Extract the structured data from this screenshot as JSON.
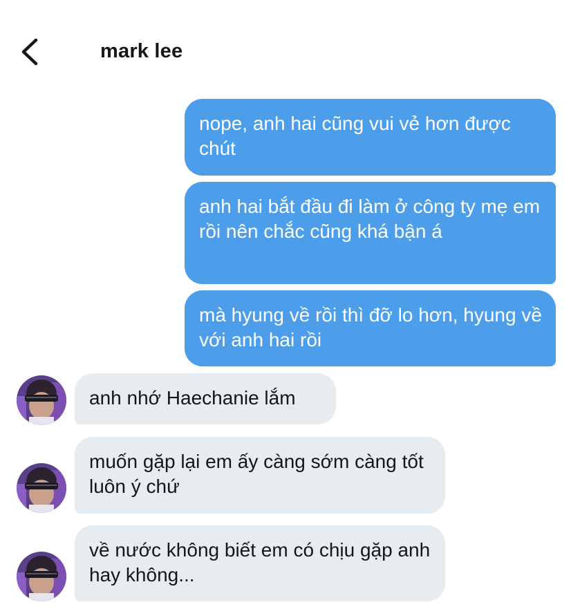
{
  "header": {
    "back_icon": "chevron-left-icon",
    "contact_name": "mark lee"
  },
  "messages": [
    {
      "direction": "sent",
      "text": "nope, anh hai cũng vui vẻ hơn được chút"
    },
    {
      "direction": "sent",
      "text": "anh hai bắt đầu đi làm ở công ty mẹ em rồi nên chắc cũng khá bận á"
    },
    {
      "direction": "sent",
      "text": "mà hyung về rồi thì đỡ lo hơn, hyung về với anh hai rồi"
    },
    {
      "direction": "received",
      "text": "anh nhớ Haechanie lắm"
    },
    {
      "direction": "received",
      "text": "muốn gặp lại em ấy càng sớm càng tốt luôn ý chứ"
    },
    {
      "direction": "received",
      "text": "về nước không biết em có chịu gặp anh hay không..."
    }
  ],
  "colors": {
    "sent_bubble": "#4c9eea",
    "received_bubble": "#e6ecf0",
    "text_dark": "#14171a"
  }
}
